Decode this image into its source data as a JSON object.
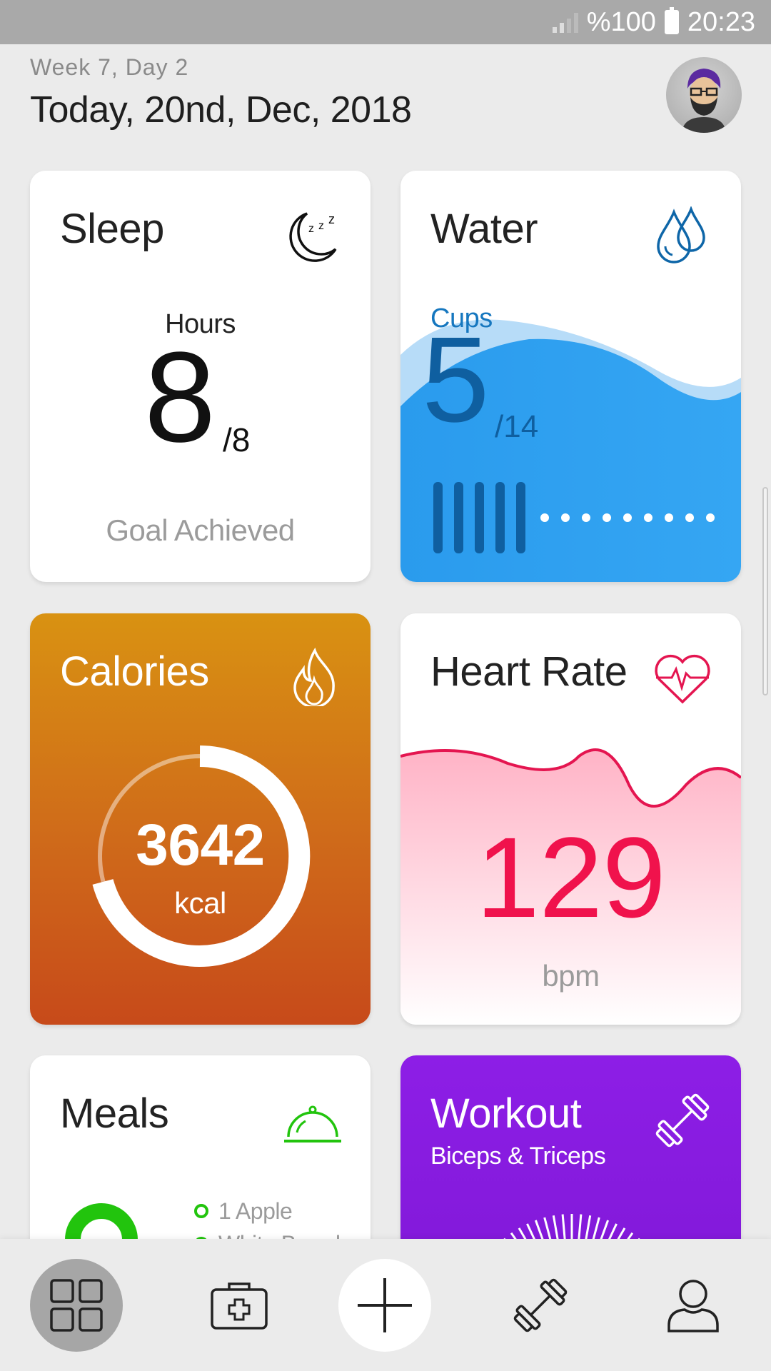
{
  "status_bar": {
    "battery": "%100",
    "time": "20:23"
  },
  "header": {
    "week": "Week 7, Day 2",
    "date": "Today, 20nd, Dec, 2018"
  },
  "sleep": {
    "title": "Sleep",
    "unit_label": "Hours",
    "value": "8",
    "goal": "/8",
    "status": "Goal Achieved"
  },
  "water": {
    "title": "Water",
    "unit_label": "Cups",
    "value": "5",
    "goal": "/14",
    "cups_filled": 5,
    "cups_total": 14
  },
  "calories": {
    "title": "Calories",
    "value": "3642",
    "unit": "kcal"
  },
  "heart_rate": {
    "title": "Heart Rate",
    "value": "129",
    "unit": "bpm"
  },
  "meals": {
    "title": "Meals",
    "items": [
      "1 Apple",
      "White Bread"
    ]
  },
  "workout": {
    "title": "Workout",
    "subtitle": "Biceps & Triceps"
  },
  "colors": {
    "water_blue": "#2d9cf0",
    "heart_red": "#f0124c",
    "meals_green": "#22c40d",
    "workout_purple": "#8d1ee6"
  }
}
